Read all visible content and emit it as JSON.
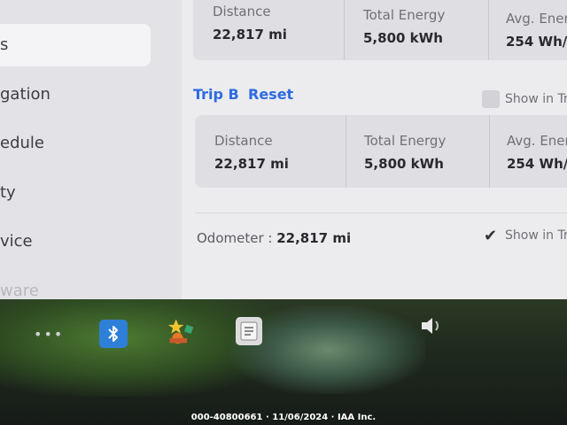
{
  "sidebar": {
    "items": [
      {
        "label": "s"
      },
      {
        "label": "gation"
      },
      {
        "label": "edule"
      },
      {
        "label": "ty"
      },
      {
        "label": "vice"
      },
      {
        "label": "ware"
      }
    ]
  },
  "trip_a": {
    "distance_label": "Distance",
    "distance_value": "22,817 mi",
    "energy_label": "Total Energy",
    "energy_value": "5,800 kWh",
    "avg_label": "Avg. Ener",
    "avg_value": "254 Wh/n"
  },
  "trip_b": {
    "title": "Trip B",
    "reset_label": "Reset",
    "show_label": "Show in Tr",
    "distance_label": "Distance",
    "distance_value": "22,817 mi",
    "energy_label": "Total Energy",
    "energy_value": "5,800 kWh",
    "avg_label": "Avg. Ener",
    "avg_value": "254 Wh/r"
  },
  "odometer": {
    "label": "Odometer :",
    "value": "22,817 mi",
    "show_label": "Show in Tr",
    "checked": true
  },
  "taskbar": {
    "icons": [
      "more-dots-icon",
      "bluetooth-icon",
      "toybox-icon",
      "notepad-icon",
      "volume-icon"
    ]
  },
  "watermark": "000-40800661 · 11/06/2024 · IAA Inc."
}
